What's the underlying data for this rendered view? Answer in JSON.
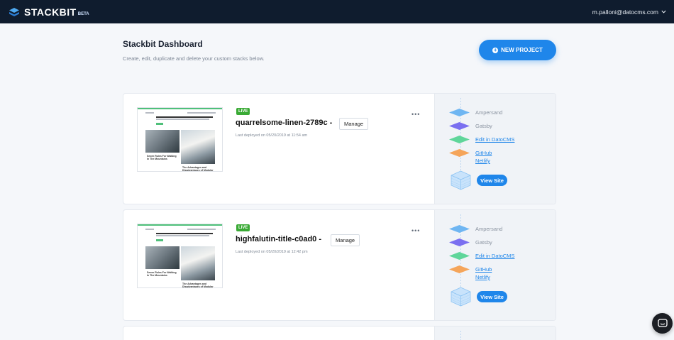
{
  "topbar": {
    "logo_text": "STACKBIT",
    "logo_badge": "BETA",
    "user_email": "m.palloni@datocms.com"
  },
  "header": {
    "title": "Stackbit Dashboard",
    "subtitle": "Create, edit, duplicate and delete your custom stacks below.",
    "new_project_label": "NEW PROJECT"
  },
  "projects": [
    {
      "status": "LIVE",
      "name": "quarrelsome-linen-2789c -",
      "manage_label": "Manage",
      "deployed": "Last deployed on 05/20/2019 at 11:54 am",
      "stack": [
        "Ampersand",
        "Gatsby",
        "Edit in DatoCMS",
        "GitHub",
        "Netlify"
      ],
      "view_site_label": "View Site",
      "thumb_caption_1": "Seven Rules For Walking In The Mountains",
      "thumb_caption_2": "The Advantages and Disadvantages of Modular Form"
    },
    {
      "status": "LIVE",
      "name": "highfalutin-title-c0ad0 -",
      "manage_label": "Manage",
      "deployed": "Last deployed on 05/20/2019 at 12:42 pm",
      "stack": [
        "Ampersand",
        "Gatsby",
        "Edit in DatoCMS",
        "GitHub",
        "Netlify"
      ],
      "view_site_label": "View Site",
      "thumb_caption_1": "Seven Rules For Walking In The Mountains",
      "thumb_caption_2": "The Advantages and Disadvantages of Modular Form"
    }
  ],
  "colors": {
    "topbar": "#0f1c2e",
    "accent": "#1f86ea",
    "live": "#3aaa35",
    "ampersand": "#6fb6f2",
    "gatsby": "#7a6ff0",
    "datocms": "#5fd69a",
    "github": "#f5a55a"
  },
  "icons": {
    "logo": "stackbit-logo-icon",
    "user_menu": "chevron-down-icon",
    "new_project": "plus-circle-icon",
    "more": "more-dots-icon",
    "chat": "chat-bubble-icon"
  }
}
